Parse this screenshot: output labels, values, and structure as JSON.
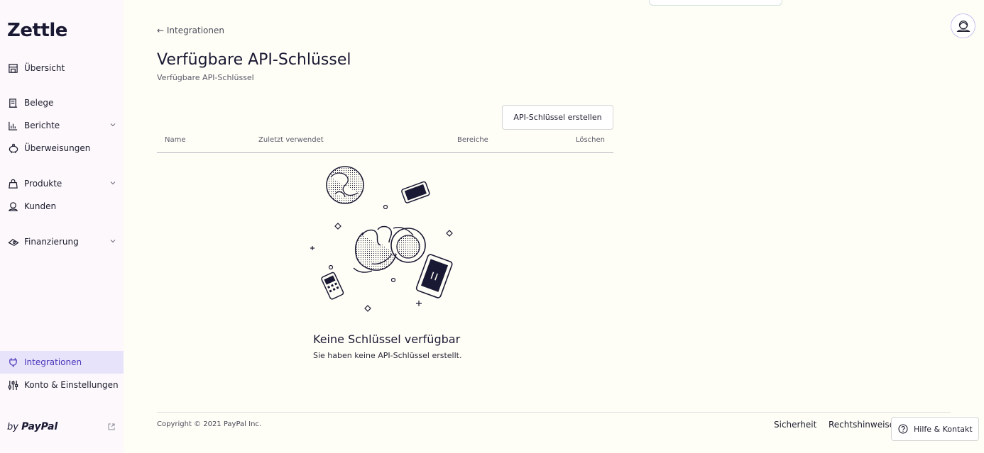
{
  "app": {
    "logo": "Zettle",
    "brand_footer_prefix": "by",
    "brand_footer_name": "PayPal"
  },
  "sidebar": {
    "items": [
      {
        "label": "Übersicht",
        "icon": "store-icon"
      },
      {
        "label": "Belege",
        "icon": "receipt-icon"
      },
      {
        "label": "Berichte",
        "icon": "chart-icon",
        "expandable": true
      },
      {
        "label": "Überweisungen",
        "icon": "piggy-bank-icon"
      },
      {
        "label": "Produkte",
        "icon": "bag-icon",
        "expandable": true
      },
      {
        "label": "Kunden",
        "icon": "customer-icon"
      },
      {
        "label": "Finanzierung",
        "icon": "funding-icon",
        "expandable": true
      },
      {
        "label": "Integrationen",
        "icon": "plug-icon",
        "active": true
      },
      {
        "label": "Konto & Einstellungen",
        "icon": "sliders-icon"
      }
    ]
  },
  "header": {
    "back_label": "← Integrationen",
    "title": "Verfügbare API-Schlüssel",
    "subtitle": "Verfügbare API-Schlüssel"
  },
  "actions": {
    "create_label": "API-Schlüssel erstellen"
  },
  "table": {
    "columns": [
      "Name",
      "Zuletzt verwendet",
      "Bereiche",
      "Löschen"
    ]
  },
  "empty_state": {
    "title": "Keine Schlüssel verfügbar",
    "message": "Sie haben keine API-Schlüssel erstellt."
  },
  "footer": {
    "copyright": "Copyright ©  2021  PayPal Inc.",
    "links": [
      "Sicherheit",
      "Rechtshinweise"
    ],
    "help_label": "Hilfe & Kontakt"
  },
  "colors": {
    "accent": "#4c38b9",
    "active_bg": "#e7e3fb",
    "sidebar_bg": "#fcf8fb",
    "page_bg": "#fffef6"
  }
}
